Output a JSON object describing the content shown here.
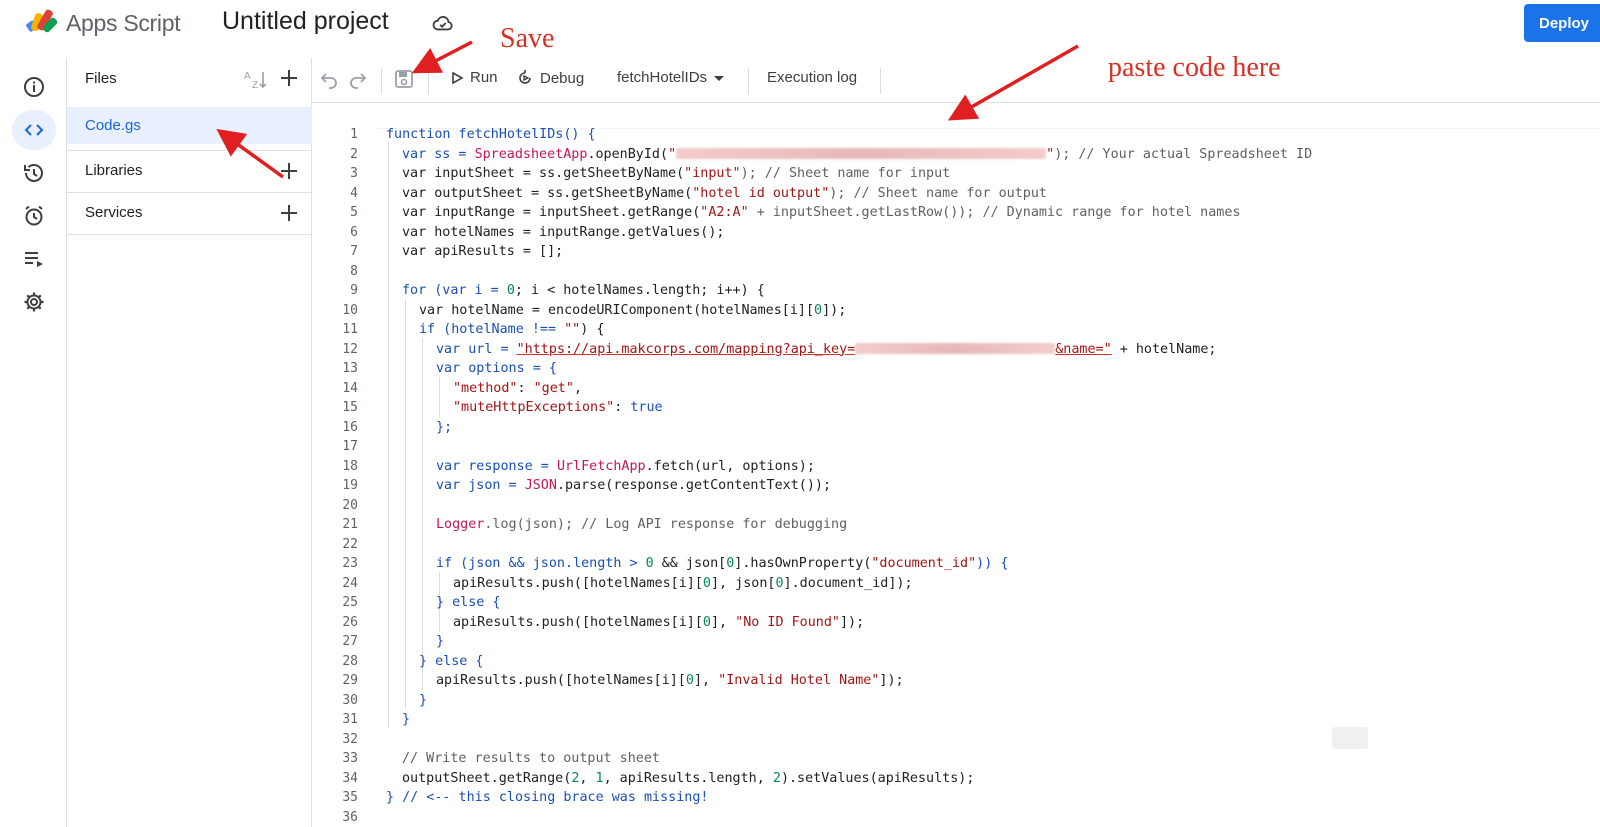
{
  "app": {
    "name": "Apps Script",
    "project_title": "Untitled project",
    "deploy_label": "Deploy"
  },
  "annotations": {
    "save": "Save",
    "paste": "paste code here"
  },
  "rail": {
    "items": [
      "info-icon",
      "code-icon",
      "history-icon",
      "triggers-icon",
      "executions-icon",
      "settings-icon"
    ]
  },
  "files": {
    "header": "Files",
    "items": [
      {
        "name": "Code.gs"
      }
    ],
    "libraries_label": "Libraries",
    "services_label": "Services"
  },
  "toolbar": {
    "run_label": "Run",
    "debug_label": "Debug",
    "function_selected": "fetchHotelIDs",
    "execution_log_label": "Execution log"
  },
  "editor": {
    "lines": [
      "1",
      "2",
      "3",
      "4",
      "5",
      "6",
      "7",
      "8",
      "9",
      "10",
      "11",
      "12",
      "13",
      "14",
      "15",
      "16",
      "17",
      "18",
      "19",
      "20",
      "21",
      "22",
      "23",
      "24",
      "25",
      "26",
      "27",
      "28",
      "29",
      "30",
      "31",
      "32",
      "33",
      "34",
      "35",
      "36"
    ],
    "code": {
      "l1a": "function fetchHotelIDs() {",
      "l2a": "var ss = ",
      "l2b": "SpreadsheetApp",
      "l2c": ".openById(",
      "l2d": "\"",
      "l2e": "\"",
      "l2f": "); // Your actual Spreadsheet ID",
      "l3a": "var inputSheet = ss.getSheetByName(",
      "l3b": "\"input\"",
      "l3c": "); // Sheet name for input",
      "l4a": "var outputSheet = ss.getSheetByName(",
      "l4b": "\"hotel id output\"",
      "l4c": "); // Sheet name for output",
      "l5a": "var inputRange = inputSheet.getRange(",
      "l5b": "\"A2:A\"",
      "l5c": " + inputSheet.getLastRow()); // Dynamic range for hotel names",
      "l6a": "var hotelNames = inputRange.getValues();",
      "l7a": "var apiResults = [];",
      "l9a": "for (var i = ",
      "l9b": "0",
      "l9c": "; i < hotelNames.length; i++) {",
      "l10a": "var hotelName = encodeURIComponent(hotelNames[i][",
      "l10b": "0",
      "l10c": "]);",
      "l11a": "if (hotelName !== ",
      "l11b": "\"\"",
      "l11c": ") {",
      "l12a": "var url = ",
      "l12b": "\"https://api.makcorps.com/mapping?api_key=",
      "l12c": "&name=\"",
      "l12d": " + hotelName;",
      "l13a": "var options = {",
      "l14a": "\"method\"",
      "l14b": ": ",
      "l14c": "\"get\"",
      "l14d": ",",
      "l15a": "\"muteHttpExceptions\"",
      "l15b": ": ",
      "l15c": "true",
      "l16a": "};",
      "l18a": "var response = ",
      "l18b": "UrlFetchApp",
      "l18c": ".fetch(url, options);",
      "l19a": "var json = ",
      "l19b": "JSON",
      "l19c": ".parse(response.getContentText());",
      "l21a": "Logger",
      "l21b": ".log(json); // Log API response for debugging",
      "l23a": "if (json && json.length > ",
      "l23b": "0",
      "l23c": " && json[",
      "l23d": "0",
      "l23e": "].hasOwnProperty(",
      "l23f": "\"document_id\"",
      "l23g": ")) {",
      "l24a": "apiResults.push([hotelNames[i][",
      "l24b": "0",
      "l24c": "], json[",
      "l24d": "0",
      "l24e": "].document_id]);",
      "l25a": "} else {",
      "l26a": "apiResults.push([hotelNames[i][",
      "l26b": "0",
      "l26c": "], ",
      "l26d": "\"No ID Found\"",
      "l26e": "]);",
      "l27a": "}",
      "l28a": "} else {",
      "l29a": "apiResults.push([hotelNames[i][",
      "l29b": "0",
      "l29c": "], ",
      "l29d": "\"Invalid Hotel Name\"",
      "l29e": "]);",
      "l30a": "}",
      "l31a": "}",
      "l33a": "// Write results to output sheet",
      "l34a": "outputSheet.getRange(",
      "l34b": "2",
      "l34c": ", ",
      "l34d": "1",
      "l34e": ", apiResults.length, ",
      "l34f": "2",
      "l34g": ").setValues(apiResults);",
      "l35a": "} // <-- this closing brace was missing!"
    }
  },
  "colors": {
    "accent": "#1a73e8",
    "annotation": "#d93025"
  }
}
